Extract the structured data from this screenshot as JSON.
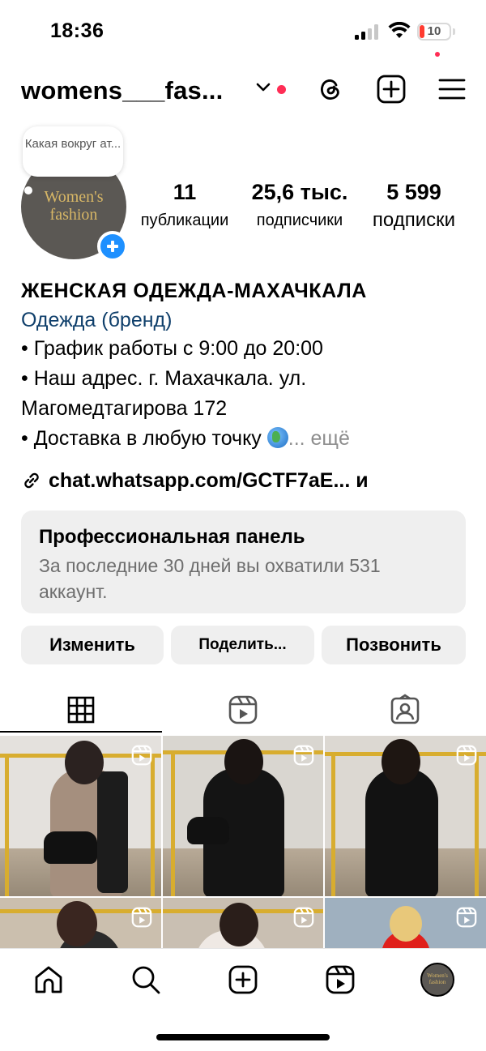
{
  "status_bar": {
    "time": "18:36",
    "battery_level": "10",
    "battery_color": "#ff3b30"
  },
  "header": {
    "username": "womens___fas...",
    "notification_dot_color": "#ff2d55"
  },
  "profile": {
    "note": "Какая вокруг ат...",
    "avatar_logo_line1": "Women's",
    "avatar_logo_line2": "fashion",
    "stats": {
      "posts": {
        "value": "11",
        "label": "публикации"
      },
      "followers": {
        "value": "25,6 тыс.",
        "label": "подписчики"
      },
      "following": {
        "value": "5 599",
        "label": "подписки"
      }
    },
    "bio": {
      "name": "ЖЕНСКАЯ  ОДЕЖДА-МАХАЧКАЛА",
      "category": "Одежда (бренд)",
      "line1": "• График работы с 9:00 до 20:00",
      "line2": "• Наш адрес. г. Махачкала. ул.",
      "line3": "Магомедтагирова 172",
      "line4": "• Доставка в любую точку ",
      "more": "... ещё"
    },
    "link": {
      "text": "chat.whatsapp.com/GCTF7aE...",
      "suffix": "и"
    }
  },
  "pro_panel": {
    "title": "Профессиональная панель",
    "subtitle": "За последние 30 дней вы охватили 531 аккаунт."
  },
  "buttons": {
    "edit": "Изменить",
    "share": "Поделить...",
    "call": "Позвонить"
  },
  "tabs": [
    {
      "icon": "grid-icon",
      "active": true
    },
    {
      "icon": "reels-icon",
      "active": false
    },
    {
      "icon": "tagged-icon",
      "active": false
    }
  ],
  "posts": [
    {
      "type": "reel",
      "description_colors": {
        "wall": "#e4e1dd",
        "outfit": "#a58f7e"
      }
    },
    {
      "type": "reel",
      "description_colors": {
        "wall": "#d9d6d0",
        "outfit": "#141414"
      }
    },
    {
      "type": "reel",
      "description_colors": {
        "wall": "#dcd8d2",
        "outfit": "#121212"
      }
    },
    {
      "type": "reel",
      "description_colors": {
        "wall": "#cbbfae",
        "outfit": "#2a2a2a"
      }
    },
    {
      "type": "reel",
      "description_colors": {
        "wall": "#c9bfb2",
        "outfit": "#efe9e4"
      }
    },
    {
      "type": "reel",
      "description_colors": {
        "wall": "#9fb0bf",
        "outfit": "#e0201b"
      }
    }
  ],
  "bottom_nav": [
    "home-icon",
    "search-icon",
    "create-icon",
    "reels-icon",
    "profile-avatar"
  ]
}
